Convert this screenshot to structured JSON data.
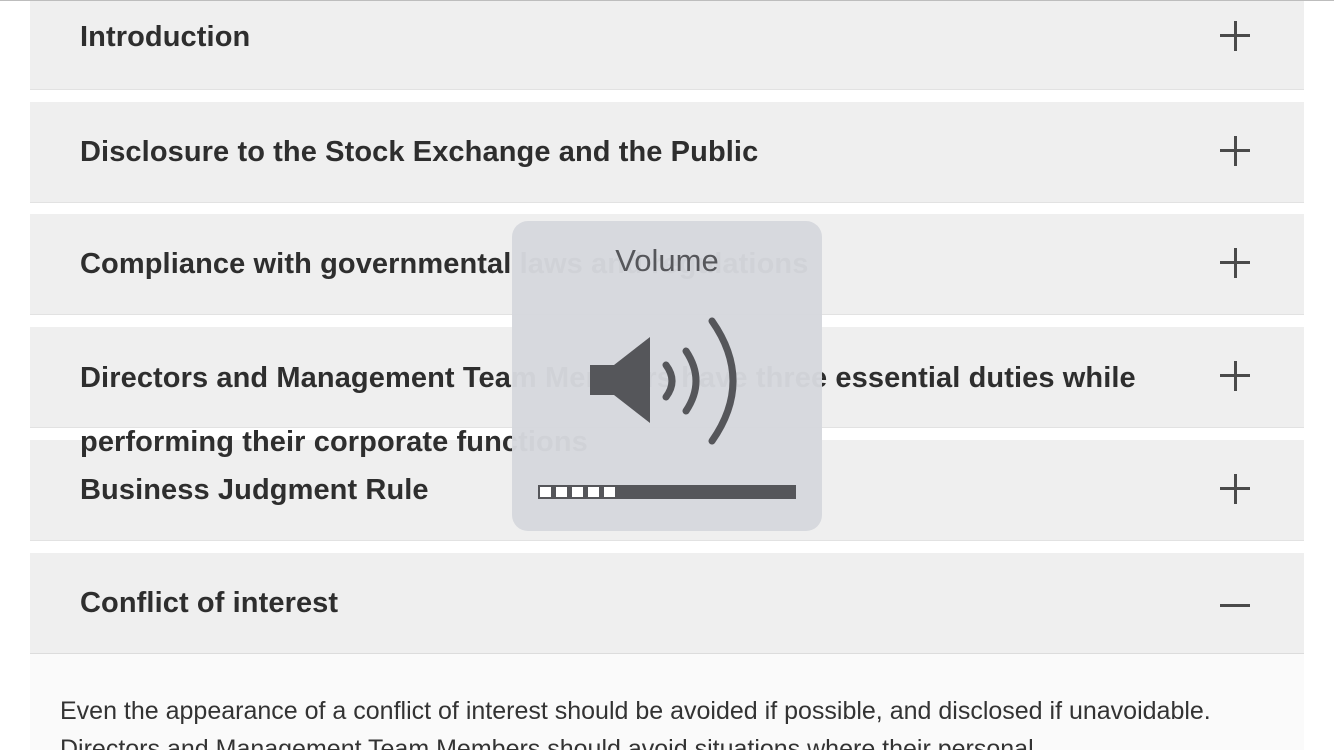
{
  "accordion": {
    "sections": [
      {
        "title": "Introduction",
        "state": "collapsed"
      },
      {
        "title": "Disclosure to the Stock Exchange and the Public",
        "state": "collapsed"
      },
      {
        "title": "Compliance with governmental laws and regulations",
        "state": "collapsed"
      },
      {
        "title": "Directors and Management Team Members have three essential duties while performing their corporate functions",
        "state": "collapsed"
      },
      {
        "title": "Business Judgment Rule",
        "state": "collapsed"
      },
      {
        "title": "Conflict of interest",
        "state": "expanded"
      }
    ],
    "expanded_content": "Even the appearance of a conflict of interest should be avoided if possible, and disclosed if unavoidable. Directors and Management Team Members should avoid situations where their personal"
  },
  "volume_hud": {
    "title": "Volume",
    "icon": "speaker-icon",
    "level": 0.3125,
    "total_segments": 16,
    "filled_segments": 5
  },
  "colors": {
    "panel_bg": "#efefef",
    "hud_bg": "#d6d8dd",
    "icon": "#4a4a4a"
  }
}
